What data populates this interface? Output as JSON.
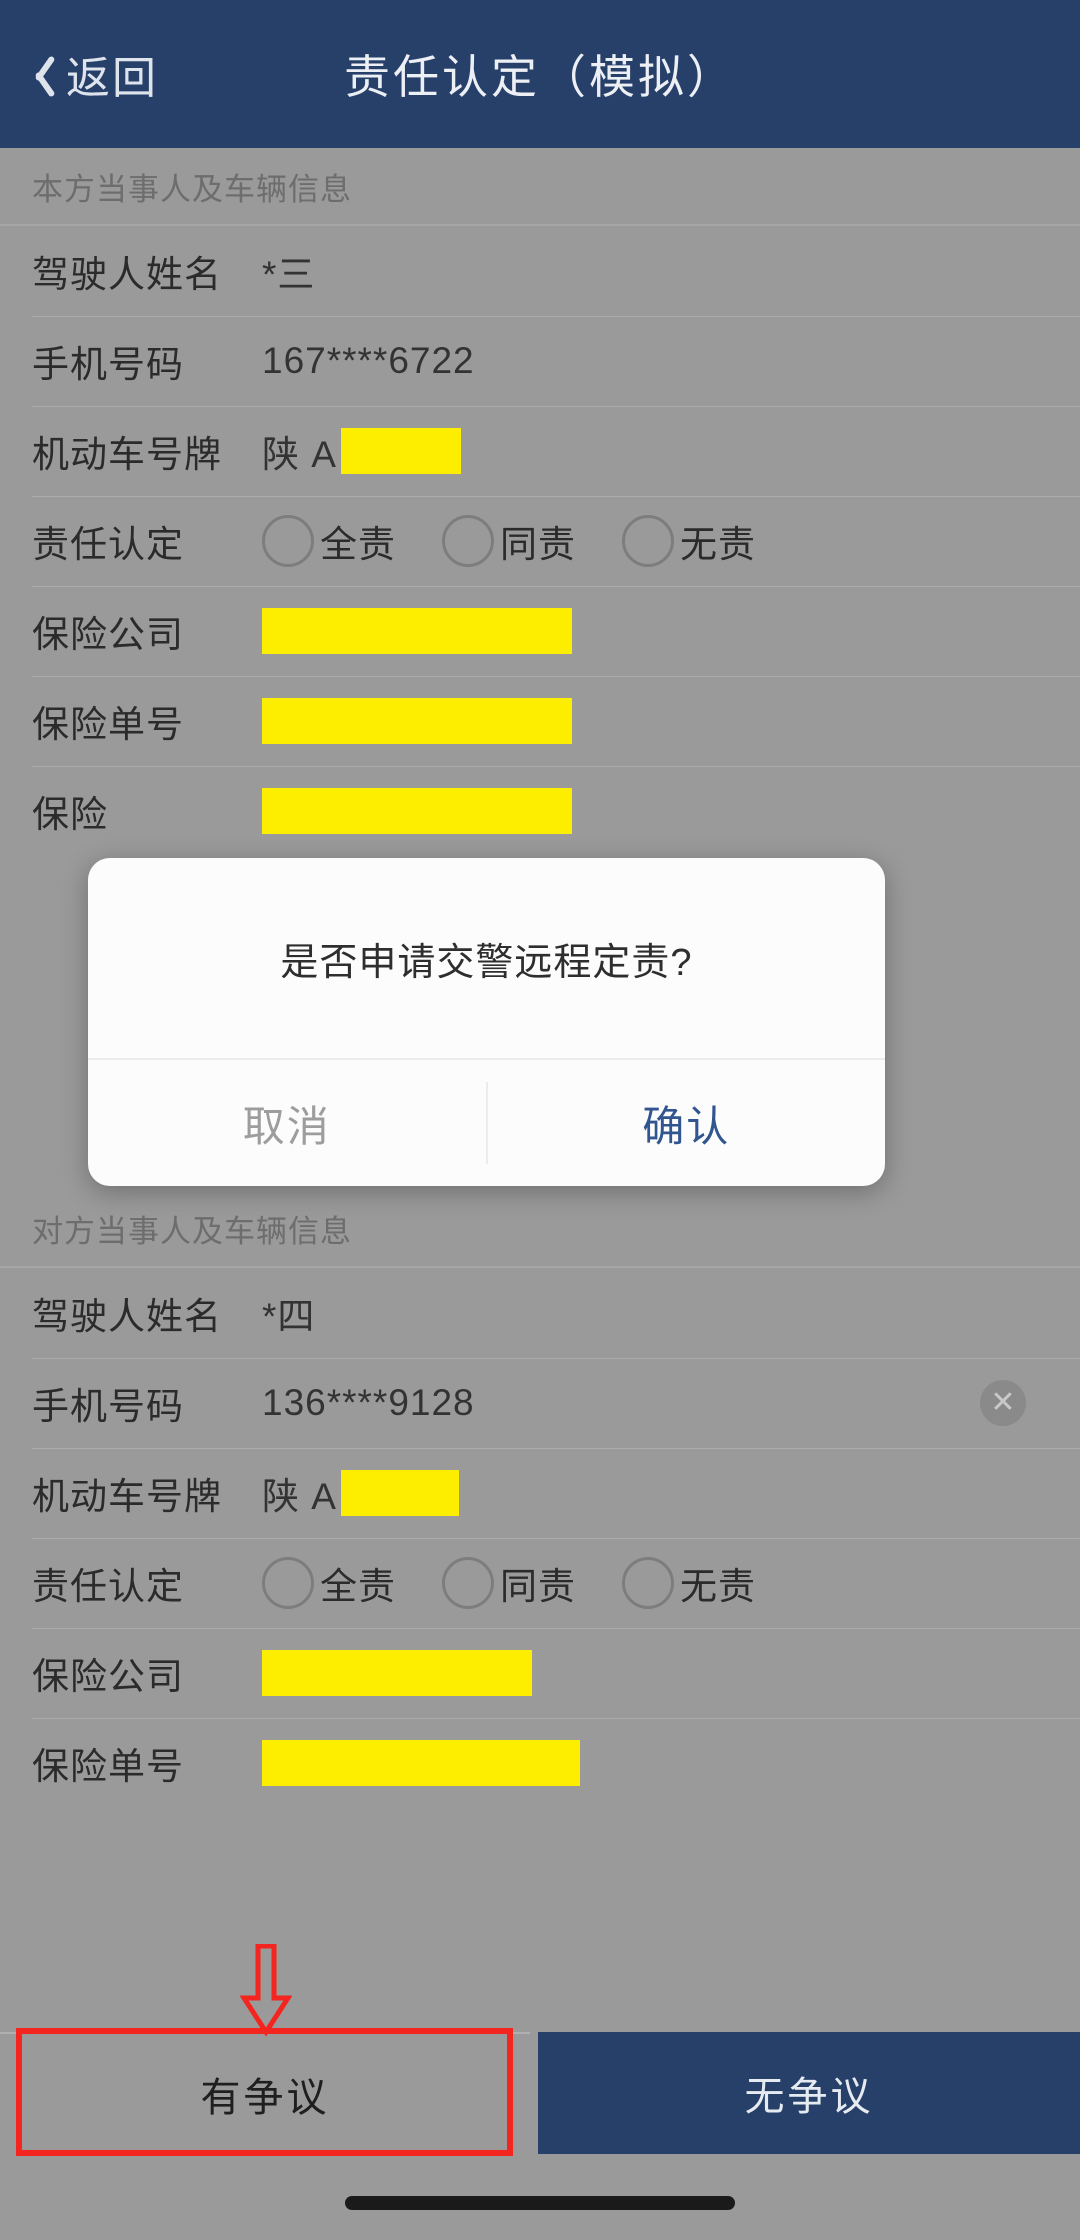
{
  "header": {
    "back_label": "返回",
    "title": "责任认定（模拟）",
    "back_icon": "chevron-left-icon",
    "bg_color": "#27406a"
  },
  "sections": [
    {
      "heading": "本方当事人及车辆信息",
      "rows": [
        {
          "label": "驾驶人姓名",
          "value": "*三",
          "type": "text"
        },
        {
          "label": "手机号码",
          "value": "167****6722",
          "type": "text"
        },
        {
          "label": "机动车号牌",
          "value": "陕 A",
          "type": "plate",
          "redacted_width": 120
        },
        {
          "label": "责任认定",
          "type": "radio",
          "options": [
            {
              "label": "全责",
              "selected": false
            },
            {
              "label": "同责",
              "selected": false
            },
            {
              "label": "无责",
              "selected": false
            }
          ]
        },
        {
          "label": "保险公司",
          "value": "",
          "type": "redacted",
          "redacted_width": 310
        },
        {
          "label": "保险单号",
          "value": "",
          "type": "redacted",
          "redacted_width": 310
        },
        {
          "label": "保险",
          "value": "",
          "type": "redacted",
          "redacted_width": 310
        }
      ]
    },
    {
      "heading": "对方当事人及车辆信息",
      "rows": [
        {
          "label": "驾驶人姓名",
          "value": "*四",
          "type": "text"
        },
        {
          "label": "手机号码",
          "value": "136****9128",
          "type": "text",
          "clear_icon": "clear-circle-icon"
        },
        {
          "label": "机动车号牌",
          "value": "陕 A",
          "type": "plate",
          "redacted_width": 118
        },
        {
          "label": "责任认定",
          "type": "radio",
          "options": [
            {
              "label": "全责",
              "selected": false
            },
            {
              "label": "同责",
              "selected": false
            },
            {
              "label": "无责",
              "selected": false
            }
          ]
        },
        {
          "label": "保险公司",
          "value": "",
          "type": "redacted",
          "redacted_width": 270
        },
        {
          "label": "保险单号",
          "value": "",
          "type": "redacted",
          "redacted_width": 318
        }
      ]
    }
  ],
  "modal": {
    "message": "是否申请交警远程定责?",
    "cancel_label": "取消",
    "confirm_label": "确认",
    "confirm_color": "#31558f"
  },
  "footer": {
    "dispute_label": "有争议",
    "no_dispute_label": "无争议"
  },
  "annotations": {
    "arrow_color": "#f4251f",
    "highlight_color": "#f4251f",
    "redaction_color": "#fdee00",
    "arrow_icon": "down-arrow-annotation-icon",
    "highlight_target": "有争议"
  }
}
